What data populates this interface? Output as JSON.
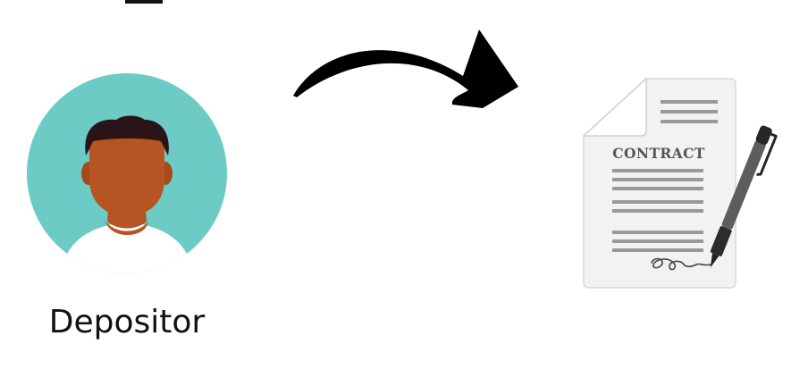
{
  "depositor": {
    "label": "Depositor",
    "icon": "person-avatar-icon",
    "circle_color": "#6ccbc4",
    "skin_color": "#b65523",
    "hair_color": "#2a1418",
    "shirt_color": "#ffffff"
  },
  "arrow": {
    "icon": "curved-arrow-icon",
    "color": "#000000"
  },
  "contract": {
    "icon": "contract-document-icon",
    "title": "CONTRACT",
    "paper_color": "#f2f2f2",
    "line_color": "#999999",
    "pen_icon": "pen-icon",
    "signature_icon": "signature-icon"
  }
}
